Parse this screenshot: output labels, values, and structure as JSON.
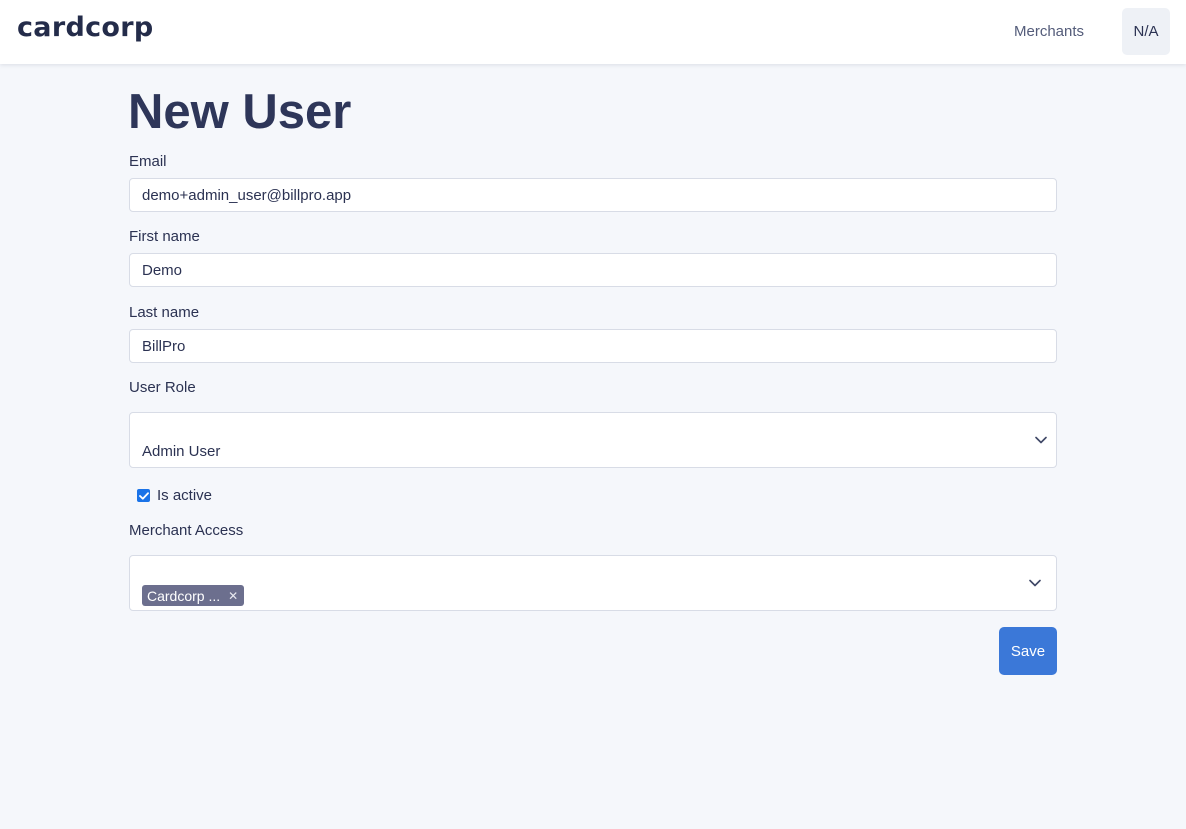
{
  "header": {
    "logo": "cardcorp",
    "nav_merchants": "Merchants",
    "user_initials": "N/A"
  },
  "page": {
    "title": "New User"
  },
  "form": {
    "email": {
      "label": "Email",
      "value": "demo+admin_user@billpro.app"
    },
    "first_name": {
      "label": "First name",
      "value": "Demo"
    },
    "last_name": {
      "label": "Last name",
      "value": "BillPro"
    },
    "user_role": {
      "label": "User Role",
      "value": "Admin User"
    },
    "is_active": {
      "label": "Is active",
      "checked": true
    },
    "merchant_access": {
      "label": "Merchant Access",
      "tags": [
        "Cardcorp ..."
      ]
    },
    "save_label": "Save"
  },
  "icons": {
    "chevron": "chevron-down-icon",
    "check": "check-icon",
    "remove": "close-icon"
  },
  "colors": {
    "accent": "#3b78d8",
    "tag": "#6c6f8e",
    "title": "#2e3659",
    "background": "#f5f7fb"
  }
}
